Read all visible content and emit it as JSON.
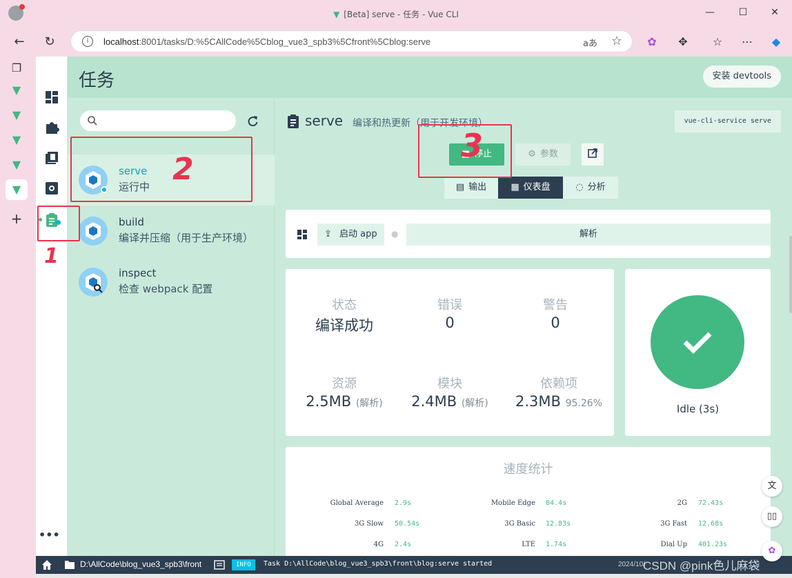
{
  "browser": {
    "window_title": "[Beta] serve - 任务 - Vue CLI",
    "url_host": "localhost",
    "url_rest": ":8001/tasks/D:%5CAllCode%5Cblog_vue3_spb3%5Cfront%5Cblog:serve",
    "read_aloud_label": "aあ"
  },
  "app": {
    "page_title": "任务",
    "devtools_button": "安装 devtools",
    "search_placeholder": ""
  },
  "tasks": [
    {
      "name": "serve",
      "description": "运行中"
    },
    {
      "name": "build",
      "description": "编译并压缩（用于生产环境）"
    },
    {
      "name": "inspect",
      "description": "检查 webpack 配置"
    }
  ],
  "task_detail": {
    "name": "serve",
    "description": "编译和热更新（用于开发环境）",
    "command": "vue-cli-service serve",
    "stop_button": "停止",
    "params_button": "参数",
    "view_tabs": [
      "输出",
      "仪表盘",
      "分析"
    ],
    "active_view_tab": "仪表盘",
    "start_app_button": "启动 app",
    "analyze_button": "解析"
  },
  "stats": {
    "status_label": "状态",
    "status_value": "编译成功",
    "errors_label": "错误",
    "errors_value": "0",
    "warnings_label": "警告",
    "warnings_value": "0",
    "assets_label": "资源",
    "assets_value": "2.5MB",
    "assets_sub": "(解析)",
    "modules_label": "模块",
    "modules_value": "2.4MB",
    "modules_sub": "(解析)",
    "deps_label": "依赖项",
    "deps_value": "2.3MB",
    "deps_sub": "95.26%"
  },
  "idle_status": "Idle (3s)",
  "speed": {
    "title": "速度统计",
    "rows": [
      [
        {
          "label": "Global Average",
          "value": "2.9s"
        },
        {
          "label": "Mobile Edge",
          "value": "84.4s"
        },
        {
          "label": "2G",
          "value": "72.43s"
        }
      ],
      [
        {
          "label": "3G Slow",
          "value": "50.54s"
        },
        {
          "label": "3G Basic",
          "value": "12.83s"
        },
        {
          "label": "3G Fast",
          "value": "12.68s"
        }
      ],
      [
        {
          "label": "4G",
          "value": "2.4s"
        },
        {
          "label": "LTE",
          "value": "1.74s"
        },
        {
          "label": "Dial Up",
          "value": "401.23s"
        }
      ]
    ]
  },
  "statusbar": {
    "path": "D:\\AllCode\\blog_vue3_spb3\\front",
    "log_level": "INFO",
    "log_message": "Task D:\\AllCode\\blog_vue3_spb3\\front\\blog:serve started",
    "timestamp": "2024/10/",
    "watermark": "CSDN @pink色儿麻袋"
  },
  "annotations": [
    "1",
    "2",
    "3"
  ],
  "colors": {
    "vue_green": "#42b883",
    "active_task_text": "#00a5d7",
    "panel_bg": "#c9eadb",
    "dark": "#2c3e50",
    "annotation_red": "#e8344e"
  }
}
